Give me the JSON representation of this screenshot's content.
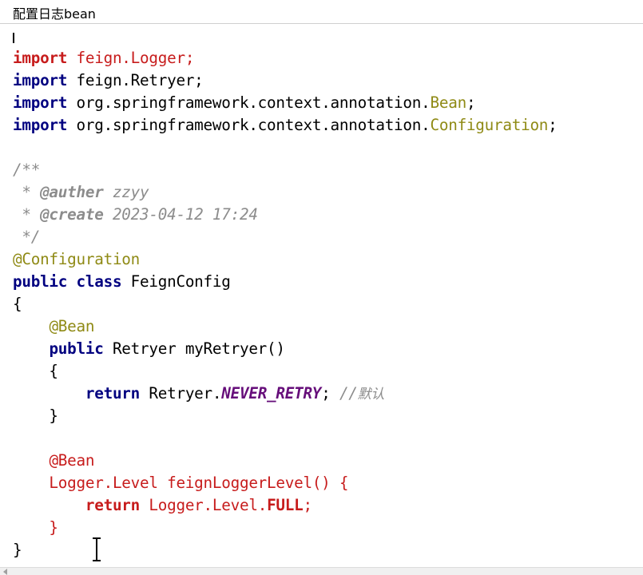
{
  "window": {
    "title": "配置日志bean"
  },
  "editor": {
    "lines": [
      [],
      [
        {
          "t": "import",
          "c": "tok-red-kw"
        },
        {
          "t": " feign.Logger;",
          "c": "tok-red"
        }
      ],
      [
        {
          "t": "import",
          "c": "tok-kw"
        },
        {
          "t": " feign.Retryer;",
          "c": "tok-plain"
        }
      ],
      [
        {
          "t": "import",
          "c": "tok-kw"
        },
        {
          "t": " org.springframework.context.annotation.",
          "c": "tok-plain"
        },
        {
          "t": "Bean",
          "c": "tok-ann"
        },
        {
          "t": ";",
          "c": "tok-plain"
        }
      ],
      [
        {
          "t": "import",
          "c": "tok-kw"
        },
        {
          "t": " org.springframework.context.annotation.",
          "c": "tok-plain"
        },
        {
          "t": "Configuration",
          "c": "tok-ann"
        },
        {
          "t": ";",
          "c": "tok-plain"
        }
      ],
      [],
      [
        {
          "t": "/**",
          "c": "tok-comment"
        }
      ],
      [
        {
          "t": " * ",
          "c": "tok-comment"
        },
        {
          "t": "@auther",
          "c": "tok-doctag"
        },
        {
          "t": " zzyy",
          "c": "tok-comment"
        }
      ],
      [
        {
          "t": " * ",
          "c": "tok-comment"
        },
        {
          "t": "@create",
          "c": "tok-doctag"
        },
        {
          "t": " 2023-04-12 17:24",
          "c": "tok-comment"
        }
      ],
      [
        {
          "t": " */",
          "c": "tok-comment"
        }
      ],
      [
        {
          "t": "@Configuration",
          "c": "tok-ann"
        }
      ],
      [
        {
          "t": "public class",
          "c": "tok-kw"
        },
        {
          "t": " FeignConfig",
          "c": "tok-plain"
        }
      ],
      [
        {
          "t": "{",
          "c": "tok-plain"
        }
      ],
      [
        {
          "t": "    ",
          "c": "tok-plain"
        },
        {
          "t": "@Bean",
          "c": "tok-ann"
        }
      ],
      [
        {
          "t": "    ",
          "c": "tok-plain"
        },
        {
          "t": "public",
          "c": "tok-kw"
        },
        {
          "t": " Retryer myRetryer()",
          "c": "tok-plain"
        }
      ],
      [
        {
          "t": "    {",
          "c": "tok-plain"
        }
      ],
      [
        {
          "t": "        ",
          "c": "tok-plain"
        },
        {
          "t": "return",
          "c": "tok-kw"
        },
        {
          "t": " Retryer.",
          "c": "tok-plain"
        },
        {
          "t": "NEVER_RETRY",
          "c": "tok-const"
        },
        {
          "t": "; ",
          "c": "tok-plain"
        },
        {
          "t": "//",
          "c": "tok-comment"
        },
        {
          "t": "默认",
          "c": "tok-comment tok-cjk"
        }
      ],
      [
        {
          "t": "    }",
          "c": "tok-plain"
        }
      ],
      [],
      [
        {
          "t": "    ",
          "c": "tok-plain"
        },
        {
          "t": "@Bean",
          "c": "tok-red"
        }
      ],
      [
        {
          "t": "    Logger.Level feignLoggerLevel() {",
          "c": "tok-red"
        }
      ],
      [
        {
          "t": "        ",
          "c": "tok-plain"
        },
        {
          "t": "return",
          "c": "tok-red-kw"
        },
        {
          "t": " Logger.Level.",
          "c": "tok-red"
        },
        {
          "t": "FULL",
          "c": "tok-red-kw"
        },
        {
          "t": ";",
          "c": "tok-red"
        }
      ],
      [
        {
          "t": "    }",
          "c": "tok-red"
        }
      ],
      [
        {
          "t": "}",
          "c": "tok-plain"
        }
      ]
    ]
  }
}
